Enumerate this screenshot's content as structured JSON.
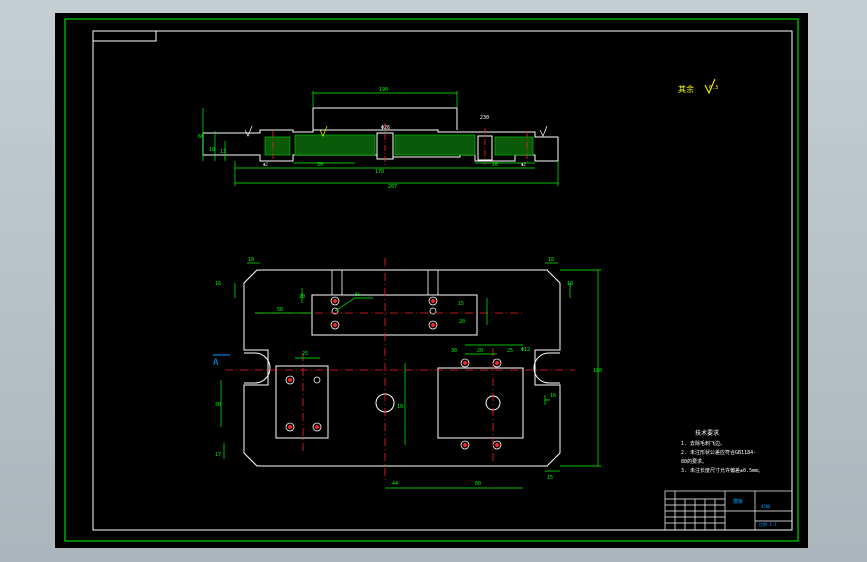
{
  "drawing": {
    "roughness_label": "其余",
    "roughness_value": "6.3",
    "tech_title": "技术要求",
    "tech_notes": [
      "1. 去除毛刺飞边。",
      "2. 未注形状公差应符合GB1184-",
      "   80的要求。",
      "3. 未注长度尺寸允许偏差±0.5mm。"
    ],
    "title_block": {
      "part_name": "模板",
      "material": "45钢",
      "scale": "比例 1:1",
      "rows": [
        "标记",
        "处数",
        "分区",
        "更改文件号",
        "签名",
        "年月日"
      ]
    },
    "section_label": "A",
    "dims_top": [
      "190",
      "30",
      "Φ26",
      "230",
      "60",
      "10",
      "13",
      "20",
      "170",
      "207",
      "Φ2",
      "Φ2"
    ],
    "dims_plan": [
      "10",
      "10",
      "16",
      "10",
      "50",
      "80",
      "20",
      "15",
      "20",
      "25",
      "30",
      "20",
      "25",
      "Φ12",
      "16",
      "30",
      "10",
      "20",
      "180",
      "44",
      "60",
      "15",
      "17"
    ],
    "colors": {
      "background": "#000000",
      "outline": "#ffffff",
      "dimension": "#00ff00",
      "centerline": "#ff2020",
      "hatch": "#00c000",
      "annotation": "#ffff00",
      "frame": "#00ff00"
    }
  }
}
